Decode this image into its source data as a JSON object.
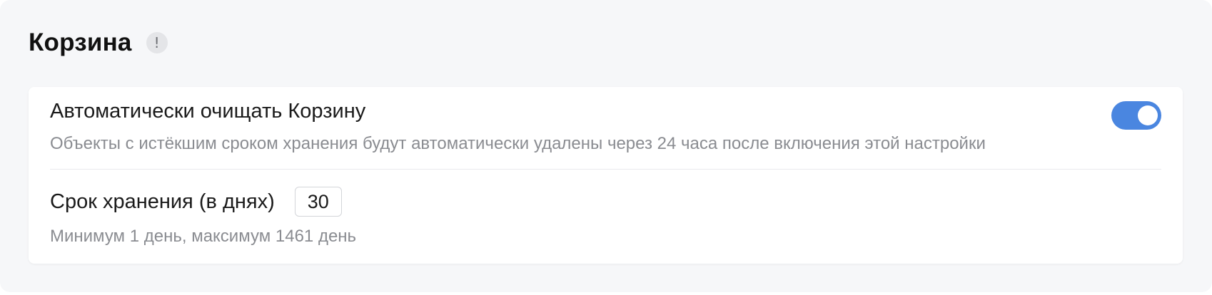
{
  "section": {
    "title": "Корзина",
    "info_icon": "exclamation-icon",
    "info_glyph": "!"
  },
  "auto_clean": {
    "label": "Автоматически очищать Корзину",
    "description": "Объекты с истёкшим сроком хранения будут автоматически удалены через 24 часа после включения этой настройки",
    "enabled": true
  },
  "retention": {
    "label": "Срок хранения (в днях)",
    "value": "30",
    "hint": "Минимум 1 день, максимум 1461 день"
  },
  "colors": {
    "toggle_on": "#4a86e0",
    "panel_bg": "#f6f7f9",
    "muted_text": "#8a8c91"
  }
}
